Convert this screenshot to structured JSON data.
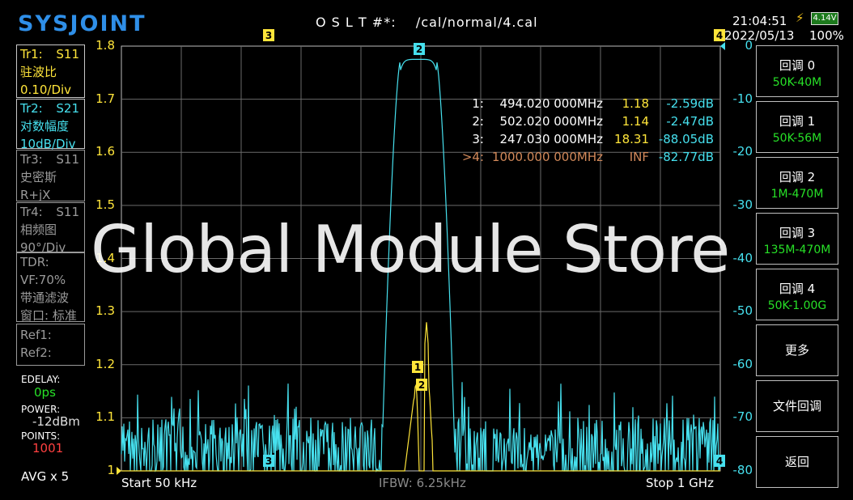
{
  "header": {
    "logo": "SYSJOINT",
    "cal": "O S L T #*:    /cal/normal/4.cal",
    "time": "21:04:51",
    "date": "2022/05/13",
    "battery_voltage": "4.14V",
    "battery_percent": "100%"
  },
  "traces": [
    {
      "name": "Tr1:",
      "param": "S11",
      "format": "驻波比",
      "scale": "0.10/Div",
      "color": "#ffe53a",
      "border": "#c8c8c8"
    },
    {
      "name": "Tr2:",
      "param": "S21",
      "format": "对数幅度",
      "scale": "10dB/Div",
      "color": "#46e0ee",
      "border": "#c8c8c8"
    },
    {
      "name": "Tr3:",
      "param": "S11",
      "format": "史密斯",
      "scale": "R+jX",
      "color": "#9a9a9a",
      "border": "#9a9a9a"
    },
    {
      "name": "Tr4:",
      "param": "S11",
      "format": "相频图",
      "scale": "90°/Div",
      "color": "#9a9a9a",
      "border": "#9a9a9a"
    }
  ],
  "tdr": {
    "line1": "TDR:",
    "line2": "VF:70%",
    "line3": "带通滤波",
    "line4": "窗口: 标准"
  },
  "ref": {
    "ref1": "Ref1:",
    "ref2": "Ref2:"
  },
  "settings": {
    "edelay_label": "EDELAY:",
    "edelay_value": "0ps",
    "power_label": "POWER:",
    "power_value": "-12dBm",
    "points_label": "POINTS:",
    "points_value": "1001",
    "avg": "AVG x 5"
  },
  "buttons": [
    {
      "title": "回调 0",
      "sub": "50K-40M"
    },
    {
      "title": "回调 1",
      "sub": "50K-56M"
    },
    {
      "title": "回调 2",
      "sub": "1M-470M"
    },
    {
      "title": "回调 3",
      "sub": "135M-470M"
    },
    {
      "title": "回调 4",
      "sub": "50K-1.00G"
    },
    {
      "title": "更多",
      "sub": ""
    },
    {
      "title": "文件回调",
      "sub": ""
    },
    {
      "title": "返回",
      "sub": ""
    }
  ],
  "markers": [
    {
      "id": "1:",
      "freq": "494.020 000MHz",
      "v1": "1.18",
      "v2": "-2.59dB",
      "color": "#ffffff"
    },
    {
      "id": "2:",
      "freq": "502.020 000MHz",
      "v1": "1.14",
      "v2": "-2.47dB",
      "color": "#ffffff"
    },
    {
      "id": "3:",
      "freq": "247.030 000MHz",
      "v1": "18.31",
      "v2": "-88.05dB",
      "color": "#ffffff"
    },
    {
      "id": ">4:",
      "freq": "1000.000 000MHz",
      "v1": "INF",
      "v2": "-82.77dB",
      "color": "#d2895a"
    }
  ],
  "axes": {
    "left_ticks": [
      "1.8",
      "1.7",
      "1.6",
      "1.5",
      "1.4",
      "1.3",
      "1.2",
      "1.1",
      "1"
    ],
    "right_ticks": [
      "0",
      "-10",
      "-20",
      "-30",
      "-40",
      "-50",
      "-60",
      "-70",
      "-80"
    ],
    "start": "Start   50 kHz",
    "ifbw": "IFBW: 6.25kHz",
    "stop": "Stop   1 GHz",
    "left_color": "#ffe53a",
    "right_color": "#46e0ee"
  },
  "marker_flags": {
    "m1": "1",
    "m2": "2",
    "m3": "3",
    "m4": "4"
  },
  "watermark": "Global Module Store"
}
